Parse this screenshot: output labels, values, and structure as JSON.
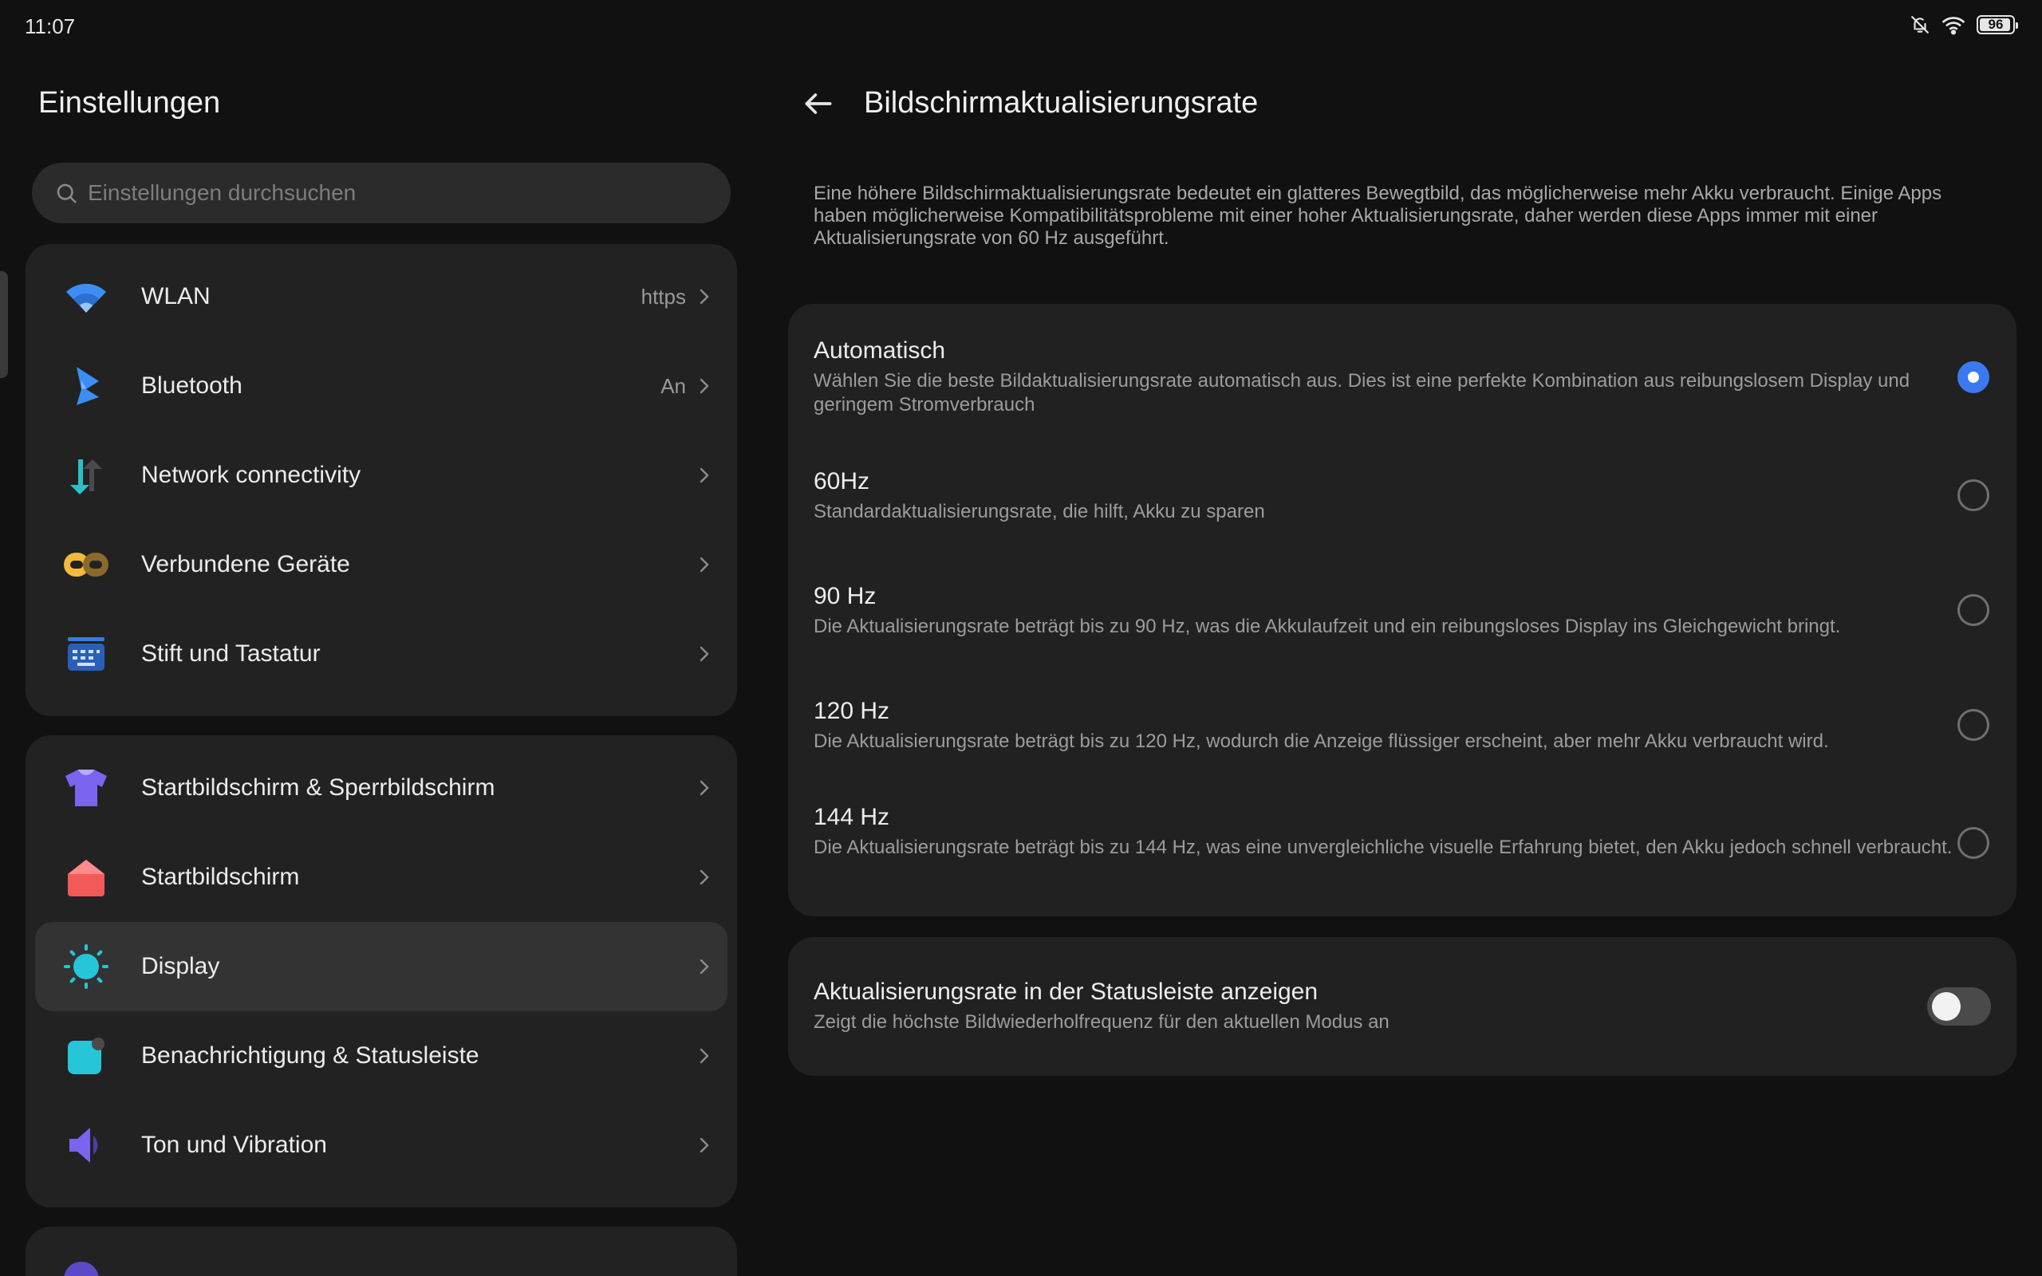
{
  "status": {
    "time": "11:07",
    "battery": "96",
    "battery_level_percent": 96
  },
  "sidebar": {
    "title": "Einstellungen",
    "search_placeholder": "Einstellungen durchsuchen",
    "group1": [
      {
        "label": "WLAN",
        "value": "https",
        "icon": "wifi-icon",
        "color": "#3c8ef5"
      },
      {
        "label": "Bluetooth",
        "value": "An",
        "icon": "bluetooth-icon",
        "color": "#3c8ef5"
      },
      {
        "label": "Network connectivity",
        "value": "",
        "icon": "network-arrows-icon",
        "color": "#2bc0c8"
      },
      {
        "label": "Verbundene Geräte",
        "value": "",
        "icon": "link-icon",
        "color": "#f4b93a"
      },
      {
        "label": "Stift und Tastatur",
        "value": "",
        "icon": "keyboard-icon",
        "color": "#3a7be0"
      }
    ],
    "group2": [
      {
        "label": "Startbildschirm & Sperrbildschirm",
        "value": "",
        "icon": "tshirt-icon",
        "color": "#7a64f0"
      },
      {
        "label": "Startbildschirm",
        "value": "",
        "icon": "home-icon",
        "color": "#f25a5a"
      },
      {
        "label": "Display",
        "value": "",
        "icon": "sun-icon",
        "color": "#27c5d8",
        "selected": true
      },
      {
        "label": "Benachrichtigung & Statusleiste",
        "value": "",
        "icon": "notification-icon",
        "color": "#27c5d8"
      },
      {
        "label": "Ton und Vibration",
        "value": "",
        "icon": "speaker-icon",
        "color": "#7a64f0"
      }
    ]
  },
  "detail": {
    "title": "Bildschirmaktualisierungsrate",
    "description": "Eine höhere Bildschirmaktualisierungsrate bedeutet ein glatteres Bewegtbild, das möglicherweise mehr Akku verbraucht. Einige Apps haben möglicherweise Kompatibilitätsprobleme mit einer hoher Aktualisierungsrate, daher werden diese Apps immer mit einer Aktualisierungsrate von 60 Hz ausgeführt.",
    "options": [
      {
        "title": "Automatisch",
        "subtitle": "Wählen Sie die beste Bildaktualisierungsrate automatisch aus. Dies ist eine perfekte Kombination aus reibungslosem Display und geringem Stromverbrauch",
        "selected": true
      },
      {
        "title": "60Hz",
        "subtitle": "Standardaktualisierungsrate, die hilft, Akku zu sparen",
        "selected": false
      },
      {
        "title": "90 Hz",
        "subtitle": "Die Aktualisierungsrate beträgt bis zu 90 Hz, was die Akkulaufzeit und ein reibungsloses Display ins Gleichgewicht bringt.",
        "selected": false
      },
      {
        "title": "120 Hz",
        "subtitle": "Die Aktualisierungsrate beträgt bis zu 120 Hz, wodurch die Anzeige flüssiger erscheint, aber mehr Akku verbraucht wird.",
        "selected": false
      },
      {
        "title": "144 Hz",
        "subtitle": "Die Aktualisierungsrate beträgt bis zu 144 Hz, was eine unvergleichliche visuelle Erfahrung bietet, den Akku jedoch schnell verbraucht.",
        "selected": false
      }
    ],
    "statusbar_toggle": {
      "title": "Aktualisierungsrate in der Statusleiste anzeigen",
      "subtitle": "Zeigt die höchste Bildwiederholfrequenz für den aktuellen Modus an",
      "on": false
    }
  },
  "colors": {
    "accent": "#3c79f0",
    "background": "#111111",
    "card": "#212121"
  }
}
